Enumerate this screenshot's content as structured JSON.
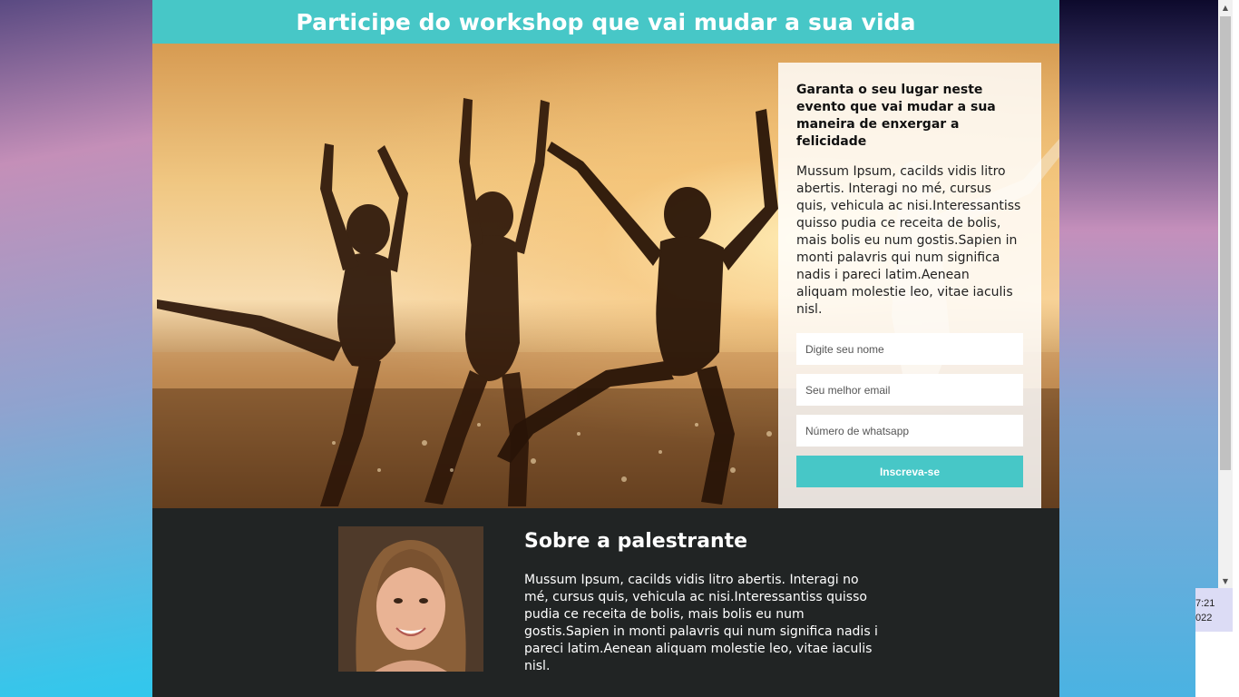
{
  "header": {
    "title": "Participe do workshop que vai mudar a sua vida"
  },
  "signup": {
    "heading": "Garanta o seu lugar neste evento que vai mudar a sua maneira de enxergar a felicidade",
    "body": "Mussum Ipsum, cacilds vidis litro abertis. Interagi no mé, cursus quis, vehicula ac nisi.Interessantiss quisso pudia ce receita de bolis, mais bolis eu num gostis.Sapien in monti palavris qui num significa nadis i pareci latim.Aenean aliquam molestie leo, vitae iaculis nisl.",
    "name_placeholder": "Digite seu nome",
    "email_placeholder": "Seu melhor email",
    "whatsapp_placeholder": "Número de whatsapp",
    "submit_label": "Inscreva-se"
  },
  "about": {
    "title": "Sobre a palestrante",
    "body": "Mussum Ipsum, cacilds vidis litro abertis. Interagi no mé, cursus quis, vehicula ac nisi.Interessantiss quisso pudia ce receita de bolis, mais bolis eu num gostis.Sapien in monti palavris qui num significa nadis i pareci latim.Aenean aliquam molestie leo, vitae iaculis nisl."
  },
  "taskbar": {
    "time": "7:21",
    "date_fragment": "022"
  },
  "colors": {
    "accent": "#47c7c7",
    "dark_section": "#212424"
  },
  "icons": {
    "scroll_up": "scroll-up-arrow-icon",
    "scroll_down": "scroll-down-arrow-icon"
  }
}
